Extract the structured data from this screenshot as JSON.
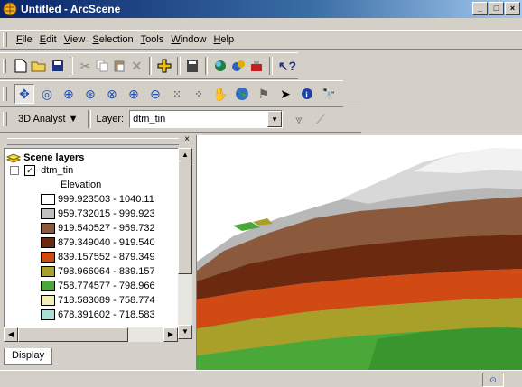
{
  "window": {
    "title": "Untitled - ArcScene"
  },
  "menu": [
    "File",
    "Edit",
    "View",
    "Selection",
    "Tools",
    "Window",
    "Help"
  ],
  "menu_accel": [
    "F",
    "E",
    "V",
    "S",
    "T",
    "W",
    "H"
  ],
  "analyst": {
    "dropdown": "3D Analyst ▼",
    "layer_label": "Layer:",
    "layer_value": "dtm_tin"
  },
  "toc": {
    "root": "Scene layers",
    "layer": "dtm_tin",
    "field": "Elevation",
    "legend": [
      {
        "label": "999.923503 - 1040.11",
        "color": "#ffffff"
      },
      {
        "label": "959.732015 - 999.923",
        "color": "#c0c0c0"
      },
      {
        "label": "919.540527 - 959.732",
        "color": "#8b5a3c"
      },
      {
        "label": "879.349040 - 919.540",
        "color": "#6b2a10"
      },
      {
        "label": "839.157552 - 879.349",
        "color": "#d14a14"
      },
      {
        "label": "798.966064 - 839.157",
        "color": "#a8a028"
      },
      {
        "label": "758.774577 - 798.966",
        "color": "#4aa838"
      },
      {
        "label": "718.583089 - 758.774",
        "color": "#f0f0b8"
      },
      {
        "label": "678.391602 - 718.583",
        "color": "#a8e0d8"
      }
    ],
    "tab": "Display"
  },
  "colors": {
    "titlebar": "#0a246a",
    "face": "#d4d0c8"
  }
}
